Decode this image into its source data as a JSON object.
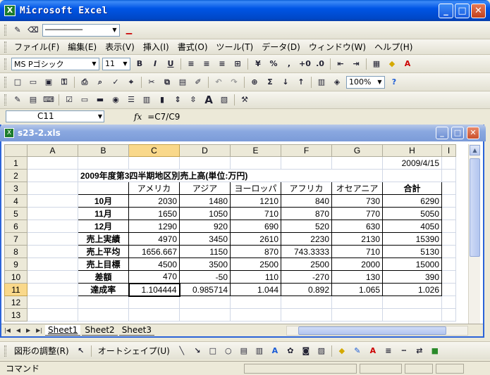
{
  "window": {
    "title": "Microsoft Excel",
    "icon_label": "X"
  },
  "drawing_style_toolbar": {
    "line_style_label": "────────"
  },
  "menu": [
    "ファイル(F)",
    "編集(E)",
    "表示(V)",
    "挿入(I)",
    "書式(O)",
    "ツール(T)",
    "データ(D)",
    "ウィンドウ(W)",
    "ヘルプ(H)"
  ],
  "format_toolbar": {
    "font": "MS Pゴシック",
    "size": "11",
    "bold": "B",
    "italic": "I",
    "underline": "U",
    "percent": "%",
    "comma": ","
  },
  "standard_toolbar": {
    "zoom": "100%"
  },
  "formula_bar": {
    "cell_ref": "C11",
    "fx_label": "fx",
    "formula": "=C7/C9"
  },
  "workbook": {
    "title": "s23-2.xls"
  },
  "sheet": {
    "columns": [
      "A",
      "B",
      "C",
      "D",
      "E",
      "F",
      "G",
      "H",
      "I"
    ],
    "rows": [
      {
        "n": "1",
        "cells": [
          "",
          "",
          "",
          "",
          "",
          "",
          "",
          "2009/4/15"
        ]
      },
      {
        "n": "2",
        "cells": [
          "",
          "2009年度第3四半期地区別売上高(単位:万円)",
          "",
          "",
          "",
          "",
          "",
          ""
        ]
      },
      {
        "n": "3",
        "cells": [
          "",
          "",
          "アメリカ",
          "アジア",
          "ヨーロッパ",
          "アフリカ",
          "オセアニア",
          "合計"
        ]
      },
      {
        "n": "4",
        "cells": [
          "",
          "10月",
          "2030",
          "1480",
          "1210",
          "840",
          "730",
          "6290"
        ]
      },
      {
        "n": "5",
        "cells": [
          "",
          "11月",
          "1650",
          "1050",
          "710",
          "870",
          "770",
          "5050"
        ]
      },
      {
        "n": "6",
        "cells": [
          "",
          "12月",
          "1290",
          "920",
          "690",
          "520",
          "630",
          "4050"
        ]
      },
      {
        "n": "7",
        "cells": [
          "",
          "売上実績",
          "4970",
          "3450",
          "2610",
          "2230",
          "2130",
          "15390"
        ]
      },
      {
        "n": "8",
        "cells": [
          "",
          "売上平均",
          "1656.667",
          "1150",
          "870",
          "743.3333",
          "710",
          "5130"
        ]
      },
      {
        "n": "9",
        "cells": [
          "",
          "売上目標",
          "4500",
          "3500",
          "2500",
          "2500",
          "2000",
          "15000"
        ]
      },
      {
        "n": "10",
        "cells": [
          "",
          "差額",
          "470",
          "-50",
          "110",
          "-270",
          "130",
          "390"
        ]
      },
      {
        "n": "11",
        "cells": [
          "",
          "達成率",
          "1.104444",
          "0.985714",
          "1.044",
          "0.892",
          "1.065",
          "1.026"
        ]
      },
      {
        "n": "12",
        "cells": [
          "",
          "",
          "",
          "",
          "",
          "",
          "",
          ""
        ]
      },
      {
        "n": "13",
        "cells": [
          "",
          "",
          "",
          "",
          "",
          "",
          "",
          ""
        ]
      }
    ],
    "tabs": [
      "Sheet1",
      "Sheet2",
      "Sheet3"
    ]
  },
  "draw_toolbar": {
    "adjust": "図形の調整(R)",
    "autoshape": "オートシェイプ(U)"
  },
  "status": {
    "text": "コマンド"
  }
}
